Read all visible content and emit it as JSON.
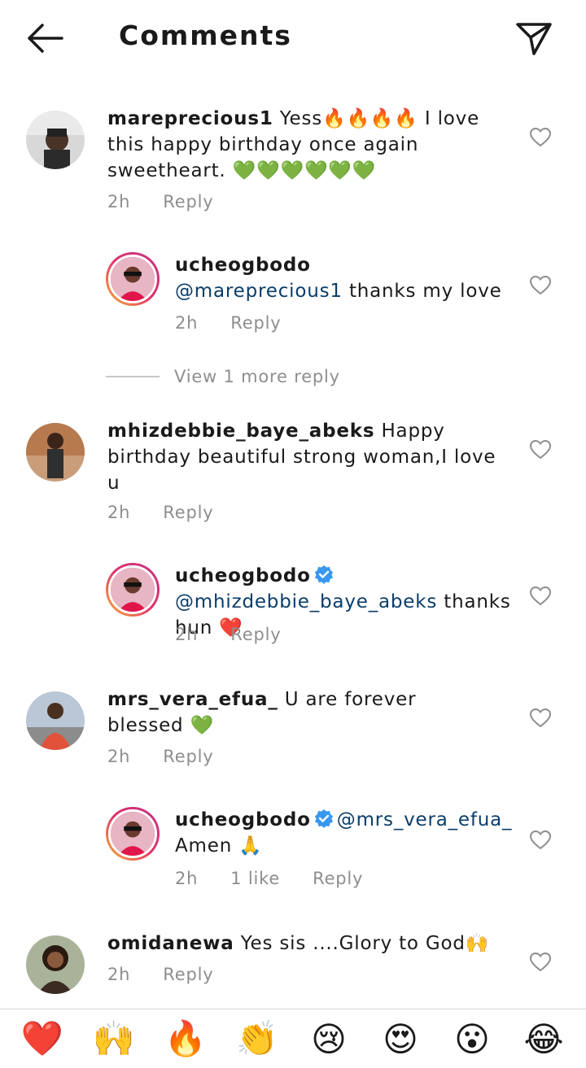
{
  "header": {
    "title": "Comments"
  },
  "comments": [
    {
      "username": "mareprecious1",
      "text": "Yess🔥🔥🔥🔥 I love this happy birthday once again sweetheart. 💚💚💚💚💚💚",
      "time": "2h",
      "reply_label": "Reply"
    },
    {
      "username": "ucheogbodo",
      "mention": "@mareprecious1",
      "text": "thanks my love",
      "time": "2h",
      "reply_label": "Reply"
    },
    {
      "username": "mhizdebbie_baye_abeks",
      "text": "Happy birthday beautiful strong woman,I love u",
      "time": "2h",
      "reply_label": "Reply"
    },
    {
      "username": "ucheogbodo",
      "mention": "@mhizdebbie_baye_abeks",
      "text": "thanks hun ❤️",
      "time": "2h",
      "reply_label": "Reply"
    },
    {
      "username": "mrs_vera_efua_",
      "text": "U are forever blessed 💚",
      "time": "2h",
      "reply_label": "Reply"
    },
    {
      "username": "ucheogbodo",
      "mention": "@mrs_vera_efua_",
      "text": "Amen 🙏",
      "time": "2h",
      "likes": "1 like",
      "reply_label": "Reply"
    },
    {
      "username": "omidanewa",
      "text": "Yes sis ....Glory to God🙌",
      "time": "2h",
      "reply_label": "Reply"
    }
  ],
  "view_more": "View 1 more reply",
  "reactions": [
    "❤️",
    "🙌",
    "🔥",
    "👏",
    "😢",
    "😍",
    "😮",
    "😂"
  ],
  "colors": {
    "mention": "#0a3d6b",
    "meta": "#8e8e8e",
    "verified": "#3897f0"
  }
}
